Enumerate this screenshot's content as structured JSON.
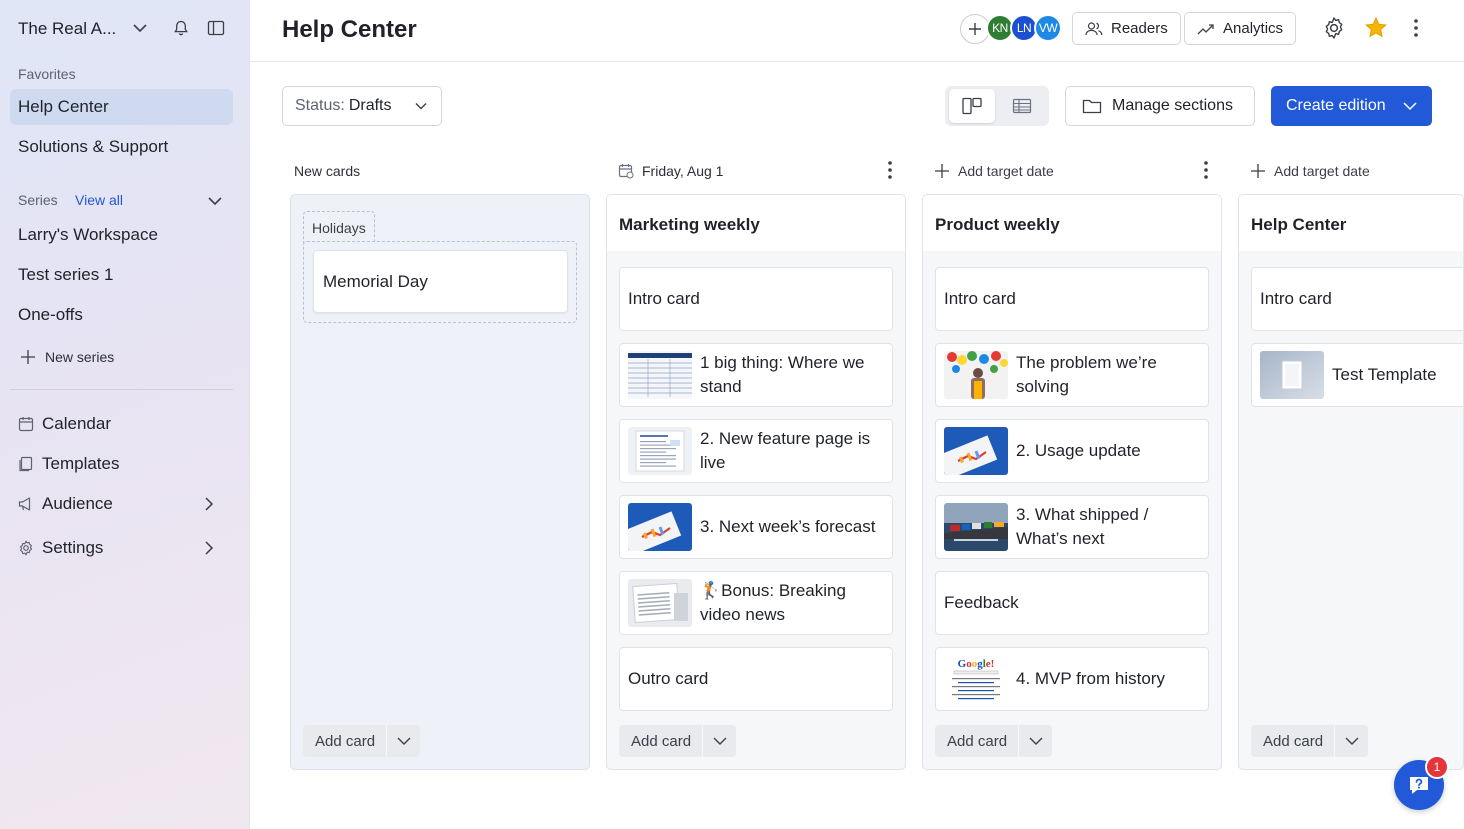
{
  "sidebar": {
    "workspace_name": "The Real A...",
    "favorites_label": "Favorites",
    "favorites": [
      {
        "label": "Help Center",
        "active": true
      },
      {
        "label": "Solutions & Support",
        "active": false
      }
    ],
    "series_label": "Series",
    "view_all": "View all",
    "series": [
      "Larry's Workspace",
      "Test series 1",
      "One-offs"
    ],
    "new_series": "New series",
    "tools": [
      {
        "label": "Calendar",
        "icon": "calendar-icon"
      },
      {
        "label": "Templates",
        "icon": "templates-icon"
      },
      {
        "label": "Audience",
        "icon": "megaphone-icon"
      },
      {
        "label": "Settings",
        "icon": "gear-icon"
      }
    ]
  },
  "header": {
    "title": "Help Center",
    "avatars": [
      {
        "initials": "KN",
        "color": "#2e7d32"
      },
      {
        "initials": "LN",
        "color": "#1d4fd1"
      },
      {
        "initials": "VW",
        "color": "#1e88e5"
      }
    ],
    "readers_label": "Readers",
    "analytics_label": "Analytics",
    "star_color": "#f5b400"
  },
  "toolbar": {
    "status_label": "Status:",
    "status_value": "Drafts",
    "manage_sections": "Manage sections",
    "create_edition": "Create edition",
    "accent_color": "#2159d8"
  },
  "board": {
    "new_cards_label": "New cards",
    "holidays_tag": "Holidays",
    "holiday_card": "Memorial Day",
    "column_headers": [
      {
        "text": "Friday, Aug 1"
      },
      {
        "text": "Add target date"
      },
      {
        "text": "Add target date"
      }
    ],
    "columns": [
      {
        "title": "Marketing weekly",
        "cards": [
          {
            "text": "Intro card",
            "thumb": ""
          },
          {
            "text": "1 big thing: Where we stand",
            "thumb": "table"
          },
          {
            "text": "2. New feature page is live",
            "thumb": "doc"
          },
          {
            "text": "3. Next week’s forecast",
            "thumb": "chart"
          },
          {
            "text": "🏌️Bonus: Breaking video news",
            "thumb": "paper"
          },
          {
            "text": "Outro card",
            "thumb": ""
          }
        ]
      },
      {
        "title": "Product weekly",
        "cards": [
          {
            "text": "Intro card",
            "thumb": ""
          },
          {
            "text": "The problem we’re solving",
            "thumb": "balloons"
          },
          {
            "text": "2. Usage update",
            "thumb": "chart"
          },
          {
            "text": "3. What shipped / What’s next",
            "thumb": "ship"
          },
          {
            "text": "Feedback",
            "thumb": ""
          },
          {
            "text": "4. MVP from history",
            "thumb": "google"
          }
        ]
      },
      {
        "title": "Help Center",
        "cards": [
          {
            "text": "Intro card",
            "thumb": ""
          },
          {
            "text": "Test Template",
            "thumb": "template"
          }
        ]
      }
    ],
    "add_card_label": "Add card"
  },
  "help_fab": {
    "badge": "1"
  }
}
